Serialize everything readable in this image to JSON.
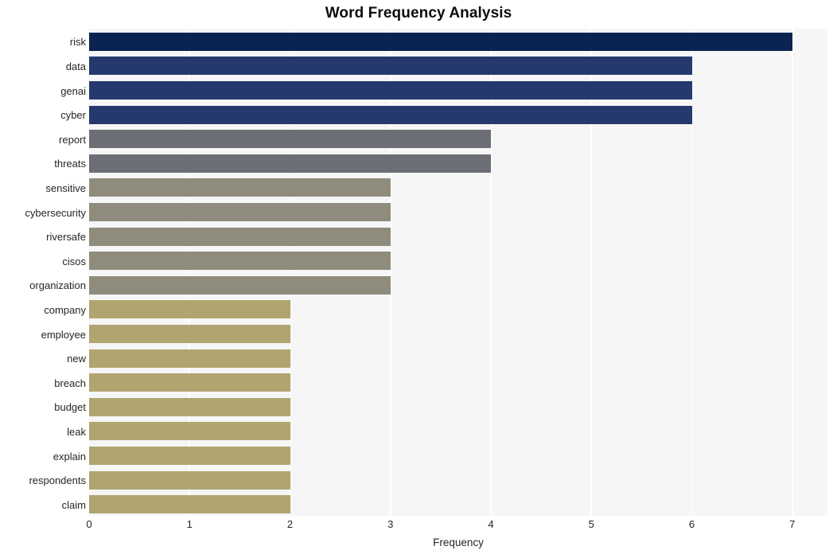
{
  "chart_data": {
    "type": "bar",
    "orientation": "horizontal",
    "title": "Word Frequency Analysis",
    "xlabel": "Frequency",
    "ylabel": "",
    "xlim": [
      0,
      7.35
    ],
    "ylim": null,
    "grid": true,
    "legend": null,
    "xticks": [
      "0",
      "1",
      "2",
      "3",
      "4",
      "5",
      "6",
      "7"
    ],
    "xtick_values": [
      0,
      1,
      2,
      3,
      4,
      5,
      6,
      7
    ],
    "categories": [
      "risk",
      "data",
      "genai",
      "cyber",
      "report",
      "threats",
      "sensitive",
      "cybersecurity",
      "riversafe",
      "cisos",
      "organization",
      "company",
      "employee",
      "new",
      "breach",
      "budget",
      "leak",
      "explain",
      "respondents",
      "claim"
    ],
    "values": [
      7,
      6,
      6,
      6,
      4,
      4,
      3,
      3,
      3,
      3,
      3,
      2,
      2,
      2,
      2,
      2,
      2,
      2,
      2,
      2
    ],
    "bar_colors": [
      "#0a2350",
      "#25396e",
      "#25396e",
      "#25396e",
      "#6b6e75",
      "#6b6e75",
      "#8f8c7d",
      "#8f8c7d",
      "#8f8c7d",
      "#8f8c7d",
      "#8f8c7d",
      "#b0a570",
      "#b0a570",
      "#b0a570",
      "#b0a570",
      "#b0a570",
      "#b0a570",
      "#b0a570",
      "#b0a570",
      "#b0a570"
    ],
    "plot_background": "#f6f6f7",
    "gridline_color": "#ffffff",
    "figure_background": "#ffffff",
    "text_color": "#262626",
    "title_color": "#0d0d0d"
  }
}
